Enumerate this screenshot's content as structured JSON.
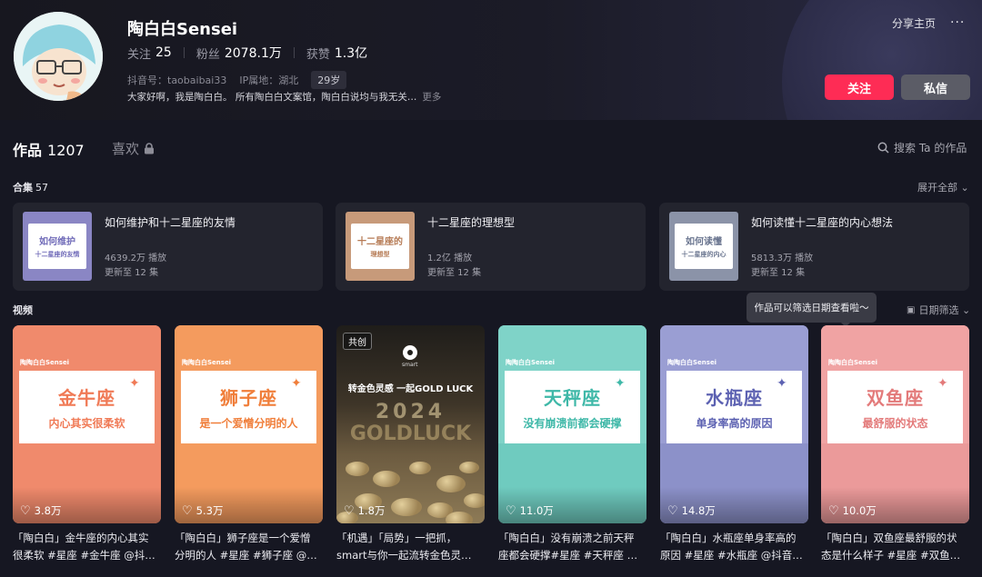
{
  "profile": {
    "name": "陶白白Sensei",
    "stats": [
      {
        "label": "关注",
        "value": "25"
      },
      {
        "label": "粉丝",
        "value": "2078.1万"
      },
      {
        "label": "获赞",
        "value": "1.3亿"
      }
    ],
    "douyin_id": "抖音号：taobaibai33",
    "ip": "IP属地：湖北",
    "age": "29岁",
    "bio": "大家好啊，我是陶白白。 所有陶白白文案馆，陶白白说均与我无关…",
    "bio_more": "更多"
  },
  "header_actions": {
    "share": "分享主页",
    "more": "···",
    "follow": "关注",
    "message": "私信"
  },
  "tabs": {
    "works_label": "作品",
    "works_count": "1207",
    "likes_label": "喜欢",
    "search": "搜索 Ta 的作品"
  },
  "collections": {
    "title": "合集",
    "count": "57",
    "expand": "展开全部",
    "items": [
      {
        "name": "如何维护和十二星座的友情",
        "plays": "4639.2万 播放",
        "updated": "更新至 12 集",
        "thumb_line1": "如何维护",
        "thumb_line2": "十二星座的友情",
        "color": "#8a86c4",
        "text_color": "#6f6ab8"
      },
      {
        "name": "十二星座的理想型",
        "plays": "1.2亿 播放",
        "updated": "更新至 12 集",
        "thumb_line1": "十二星座的",
        "thumb_line2": "理想型",
        "color": "#c79a7a",
        "text_color": "#b67b55"
      },
      {
        "name": "如何读懂十二星座的内心想法",
        "plays": "5813.3万 播放",
        "updated": "更新至 12 集",
        "thumb_line1": "如何读懂",
        "thumb_line2": "十二星座的内心",
        "color": "#8b93a8",
        "text_color": "#6b7690"
      }
    ]
  },
  "videos": {
    "title": "视频",
    "tooltip": "作品可以筛选日期查看啦～",
    "date_filter": "日期筛选",
    "items": [
      {
        "brand": "陶陶白白Sensei",
        "big": "金牛座",
        "small": "内心其实很柔软",
        "likes": "3.8万",
        "caption1": "「陶白白」金牛座的内心其实",
        "caption2": "很柔软 #星座 #金牛座 @抖…",
        "color": "#f08a6c",
        "bottom": "#f08a6c",
        "text_color": "#f07a56"
      },
      {
        "brand": "陶陶白白Sensei",
        "big": "狮子座",
        "small": "是一个爱憎分明的人",
        "likes": "5.3万",
        "caption1": "「陶白白」狮子座是一个爱憎",
        "caption2": "分明的人 #星座 #狮子座 @…",
        "color": "#f49b5e",
        "bottom": "#f49b5e",
        "text_color": "#f07e3a"
      },
      {
        "badge": "共创",
        "smart": "smart",
        "slogan": "转金色灵感 一起GOLD LUCK",
        "year": "2024",
        "gold": "GOLDLUCK",
        "likes": "1.8万",
        "caption1": "「机遇」「局势」一把抓，",
        "caption2": "smart与你一起流转金色灵…"
      },
      {
        "brand": "陶陶白白Sensei",
        "big": "天秤座",
        "small": "没有崩溃前都会硬撑",
        "likes": "11.0万",
        "caption1": "「陶白白」没有崩溃之前天秤",
        "caption2": "座都会硬撑#星座 #天秤座 …",
        "color": "#7fd3c8",
        "bottom": "#6fcbbf",
        "text_color": "#3fb8a8"
      },
      {
        "brand": "陶陶白白Sensei",
        "big": "水瓶座",
        "small": "单身率高的原因",
        "likes": "14.8万",
        "caption1": "「陶白白」水瓶座单身率高的",
        "caption2": "原因 #星座 #水瓶座 @抖音…",
        "color": "#9a9ed3",
        "bottom": "#8c91c9",
        "text_color": "#5d62b2"
      },
      {
        "brand": "陶陶白白Sensei",
        "big": "双鱼座",
        "small": "最舒服的状态",
        "likes": "10.0万",
        "caption1": "「陶白白」双鱼座最舒服的状",
        "caption2": "态是什么样子 #星座 #双鱼…",
        "color": "#f0a3a3",
        "bottom": "#eb9a9a",
        "text_color": "#e37a7a"
      }
    ]
  }
}
